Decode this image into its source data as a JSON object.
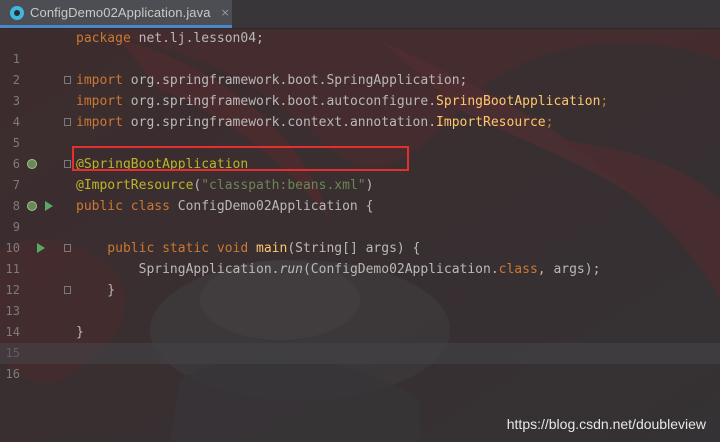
{
  "tab": {
    "filename": "ConfigDemo02Application.java",
    "close_glyph": "×"
  },
  "code": {
    "lines": [
      {
        "num": "1",
        "t": [
          "package",
          " net.lj.lesson04;"
        ]
      },
      {
        "num": "2"
      },
      {
        "num": "3",
        "t": [
          "import",
          " org.springframework.boot.SpringApplication;"
        ]
      },
      {
        "num": "4",
        "t": [
          "import",
          " org.springframework.boot.autoconfigure.",
          "SpringBootApplication",
          ";"
        ]
      },
      {
        "num": "5",
        "t": [
          "import",
          " org.springframework.context.annotation.",
          "ImportResource",
          ";"
        ]
      },
      {
        "num": "6"
      },
      {
        "num": "7",
        "t": [
          "@SpringBootApplication"
        ]
      },
      {
        "num": "8",
        "t": [
          "@ImportResource",
          "(",
          "\"classpath:beans.xml\"",
          ")"
        ]
      },
      {
        "num": "9",
        "t": [
          "public class",
          " ConfigDemo02Application {"
        ]
      },
      {
        "num": "10"
      },
      {
        "num": "11",
        "t": [
          "    public static void",
          " ",
          "main",
          "(String[] args) {"
        ]
      },
      {
        "num": "12",
        "t": [
          "        SpringApplication.",
          "run",
          "(ConfigDemo02Application.",
          "class",
          ", args);"
        ]
      },
      {
        "num": "13",
        "t": [
          "    }"
        ]
      },
      {
        "num": "14"
      },
      {
        "num": "15",
        "t": [
          "}"
        ]
      },
      {
        "num": "16"
      }
    ]
  },
  "colors": {
    "keyword": "#cc7832",
    "annotation": "#bbb529",
    "string": "#6a8759",
    "highlight_box": "#e0312f",
    "tab_underline": "#4a88c7"
  },
  "gutter_icons": {
    "line7": [
      "spring-bean-icon"
    ],
    "line9": [
      "spring-bean-icon",
      "run-icon"
    ],
    "line11": [
      "run-icon"
    ]
  },
  "watermark": "https://blog.csdn.net/doubleview"
}
